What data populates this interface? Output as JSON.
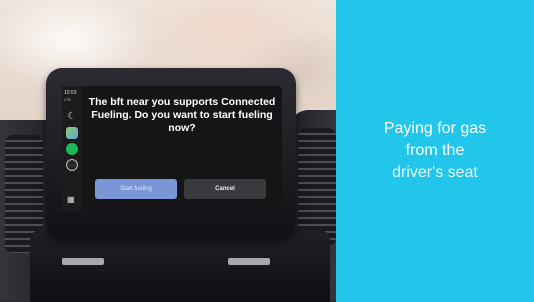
{
  "screen": {
    "clock": "10:53",
    "signal": "LTE",
    "prompt": "The bft near you supports Connected Fueling. Do you want to start fueling now?",
    "start_button": "Start fueling",
    "cancel_button": "Cancel"
  },
  "panel": {
    "line1": "Paying for gas",
    "line2": "from the",
    "line3": "driver's seat",
    "background_color": "#21c6ea"
  },
  "icons": [
    "moon-icon",
    "maps-icon",
    "spotify-icon",
    "fuel-icon",
    "app-grid-icon"
  ]
}
